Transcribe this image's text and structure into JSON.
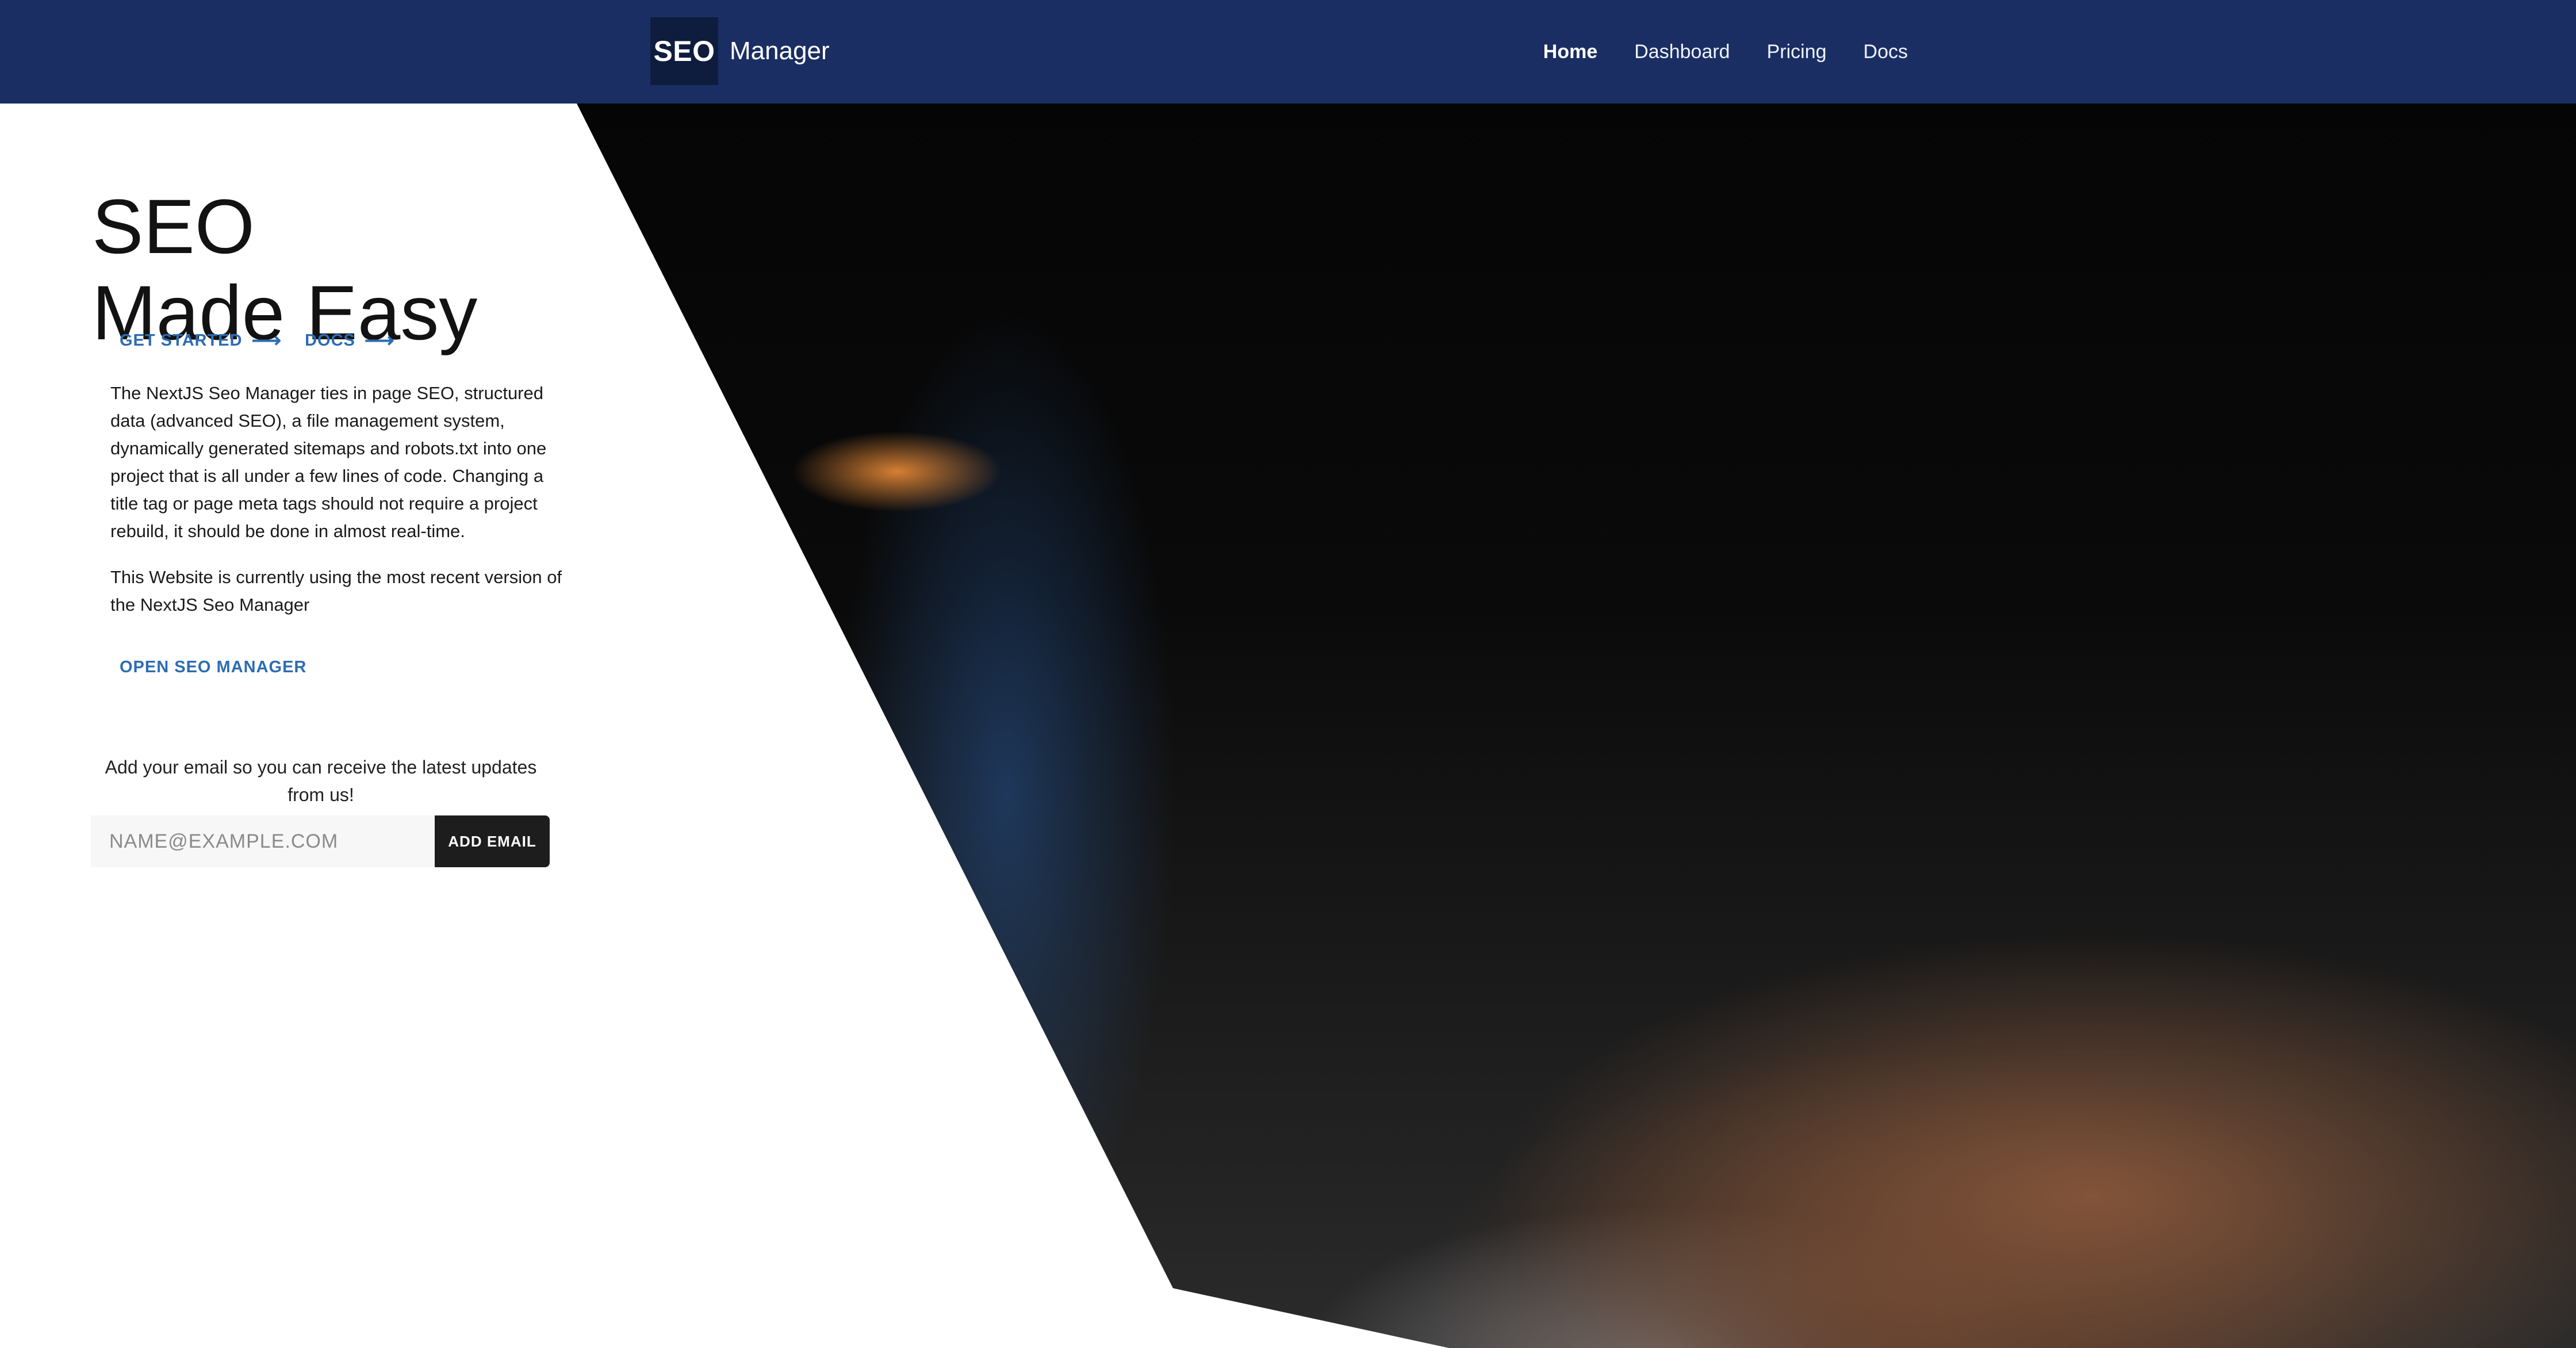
{
  "header": {
    "logo_mark": "SEO",
    "logo_text": "Manager",
    "nav": [
      "Home",
      "Dashboard",
      "Pricing",
      "Docs"
    ]
  },
  "hero": {
    "title_line1": "SEO",
    "title_line2": "Made Easy",
    "links": {
      "get_started": "GET STARTED",
      "docs": "DOCS",
      "arrow": "⟶"
    },
    "description": "The NextJS Seo Manager ties in page SEO, structured data (advanced SEO), a file management system, dynamically generated sitemaps and robots.txt into one project that is all under a few lines of code. Changing a title tag or page meta tags should not require a project rebuild, it should be done in almost real-time.",
    "status_text": "This Website is currently using the most recent version of the NextJS Seo Manager",
    "open_link": "OPEN SEO MANAGER"
  },
  "signup": {
    "prompt": "Add your email so you can receive the latest updates from us!",
    "placeholder": "NAME@EXAMPLE.COM",
    "button": "ADD EMAIL"
  },
  "colors": {
    "header_bg": "#1b2e63",
    "logo_mark_bg": "#0e1d3d",
    "link_blue": "#2d6cb3",
    "button_bg": "#1d1d1d"
  },
  "icons": [
    "arrow-right-icon"
  ]
}
